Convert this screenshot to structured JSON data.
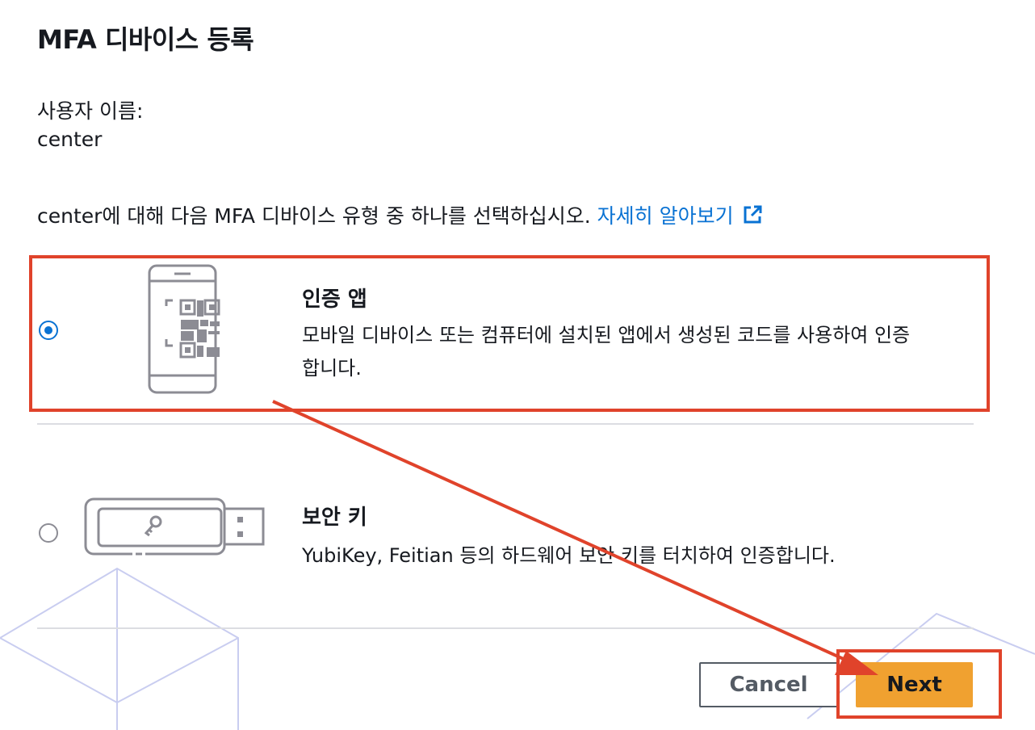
{
  "page": {
    "title": "MFA 디바이스 등록",
    "user_label": "사용자 이름:",
    "user_value": "center",
    "instruction_text": "center에 대해 다음 MFA 디바이스 유형 중 하나를 선택하십시오.",
    "learn_more_label": "자세히 알아보기"
  },
  "options": [
    {
      "title": "인증 앱",
      "description_line1": "모바일 디바이스 또는 컴퓨터에 설치된 앱에서 생성된 코드를 사용하여 인증",
      "description_line2": "합니다.",
      "selected": true,
      "icon": "phone-qr-icon"
    },
    {
      "title": "보안 키",
      "description": "YubiKey, Feitian 등의 하드웨어 보안 키를 터치하여 인증합니다.",
      "selected": false,
      "icon": "usb-security-key-icon"
    }
  ],
  "buttons": {
    "cancel": "Cancel",
    "next": "Next"
  },
  "colors": {
    "link": "#0972d3",
    "primary_button": "#f0a130",
    "annotation": "#e0432b"
  }
}
